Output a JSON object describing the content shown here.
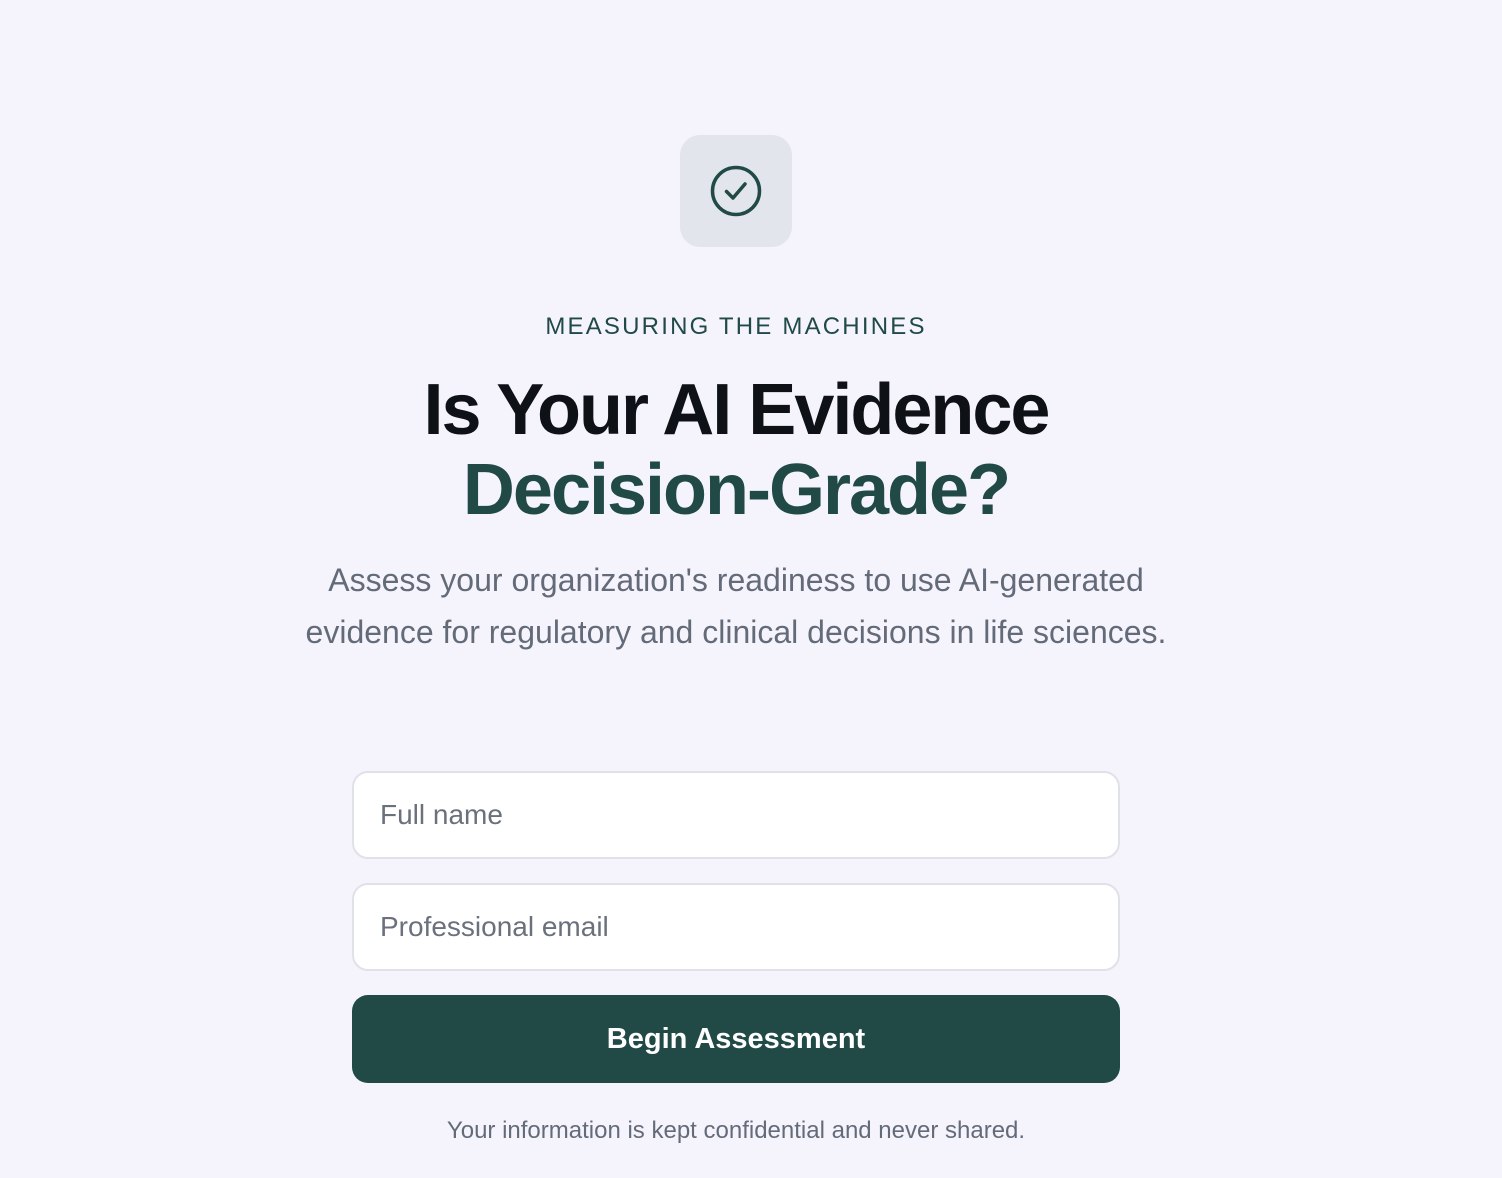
{
  "brand": {
    "accent_color": "#214a47",
    "background_color": "#f5f4fd",
    "icon": "check-circle-icon"
  },
  "hero": {
    "eyebrow": "MEASURING THE MACHINES",
    "headline_line1": "Is Your AI Evidence",
    "headline_line2": "Decision-Grade?",
    "subtitle": "Assess your organization's readiness to use AI-generated evidence for regulatory and clinical decisions in life sciences."
  },
  "form": {
    "name_placeholder": "Full name",
    "name_value": "",
    "email_placeholder": "Professional email",
    "email_value": "",
    "submit_label": "Begin Assessment",
    "privacy_note": "Your information is kept confidential and never shared."
  }
}
